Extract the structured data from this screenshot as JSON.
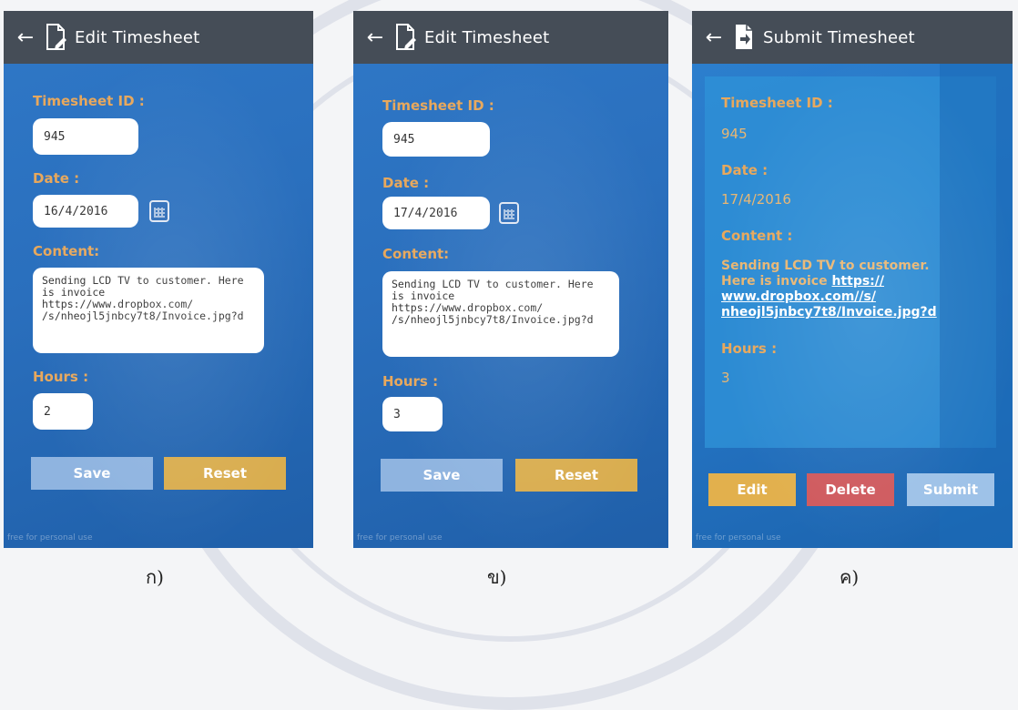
{
  "screens": [
    {
      "title": "Edit Timesheet",
      "id_label": "Timesheet ID :",
      "id_value": "945",
      "date_label": "Date :",
      "date_value": "16/4/2016",
      "content_label": "Content:",
      "content_value": "Sending LCD TV to customer. Here\nis invoice https://www.dropbox.com/\n/s/nheojl5jnbcy7t8/Invoice.jpg?d",
      "hours_label": "Hours :",
      "hours_value": "2",
      "save_label": "Save",
      "reset_label": "Reset",
      "footer": "free for personal use",
      "caption": "ก)"
    },
    {
      "title": "Edit Timesheet",
      "id_label": "Timesheet ID :",
      "id_value": "945",
      "date_label": "Date :",
      "date_value": "17/4/2016",
      "content_label": "Content:",
      "content_value": "Sending LCD TV to customer. Here\nis invoice https://www.dropbox.com/\n/s/nheojl5jnbcy7t8/Invoice.jpg?d",
      "hours_label": "Hours :",
      "hours_value": "3",
      "save_label": "Save",
      "reset_label": "Reset",
      "footer": "free for personal use",
      "caption": "ข)"
    },
    {
      "title": "Submit Timesheet",
      "id_label": "Timesheet ID :",
      "id_value": "945",
      "date_label": "Date :",
      "date_value": "17/4/2016",
      "content_label": "Content :",
      "content_text": "Sending LCD TV to customer. Here is invoice ",
      "content_link": "https:// www.dropbox.com//s/ nheojl5jnbcy7t8/Invoice.jpg?d",
      "hours_label": "Hours :",
      "hours_value": "3",
      "edit_label": "Edit",
      "delete_label": "Delete",
      "submit_label": "Submit",
      "footer": "free for personal use",
      "caption": "ค)"
    }
  ],
  "icons": {
    "back": "back-arrow-icon",
    "edit_doc": "edit-document-icon",
    "submit_doc": "submit-document-icon",
    "calendar": "calendar-icon"
  },
  "colors": {
    "topbar": "#454d57",
    "background": "#2a6fbd",
    "label": "#e8a85c",
    "save": "#8fb4e0",
    "reset": "#d9ad4f",
    "delete": "#cf5a5e"
  }
}
